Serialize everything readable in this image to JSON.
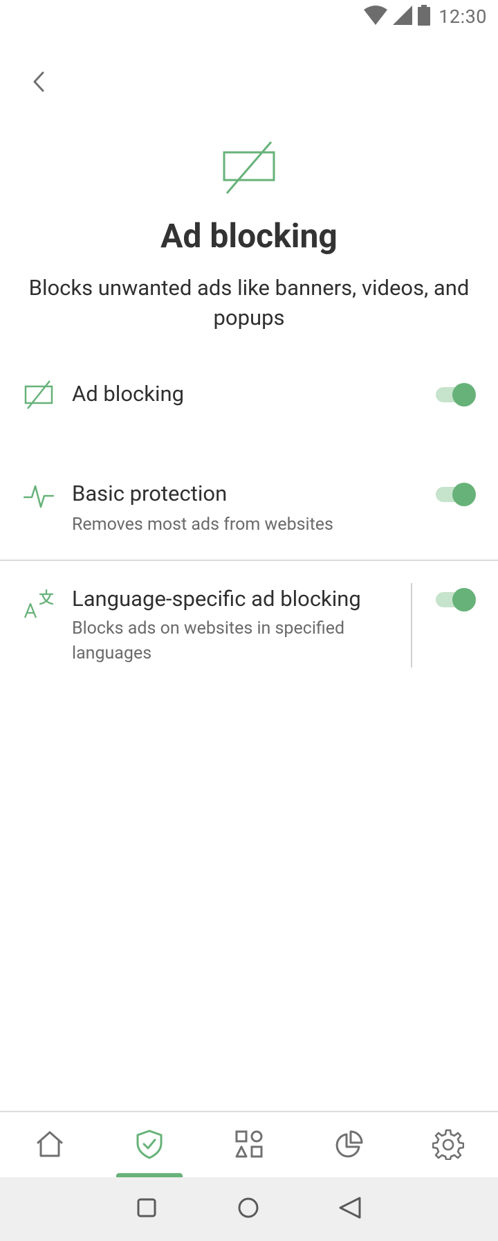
{
  "status_bar": {
    "time": "12:30",
    "icons": [
      "wifi-icon",
      "cell-signal-icon",
      "battery-icon"
    ]
  },
  "header": {
    "back_icon": "chevron-left-icon",
    "hero_icon": "ad-block-icon",
    "title": "Ad blocking",
    "subtitle": "Blocks unwanted ads like banners, videos, and popups"
  },
  "settings": [
    {
      "icon": "ad-block-icon",
      "title": "Ad blocking",
      "description": "",
      "enabled": true
    },
    {
      "icon": "pulse-icon",
      "title": "Basic protection",
      "description": "Removes most ads from websites",
      "enabled": true
    },
    {
      "icon": "translate-icon",
      "title": "Language-specific ad blocking",
      "description": "Blocks ads on websites in specified languages",
      "enabled": true
    }
  ],
  "bottom_nav": {
    "items": [
      {
        "icon": "home-icon",
        "active": false
      },
      {
        "icon": "shield-check-icon",
        "active": true
      },
      {
        "icon": "apps-icon",
        "active": false
      },
      {
        "icon": "pie-chart-icon",
        "active": false
      },
      {
        "icon": "gear-icon",
        "active": false
      }
    ]
  },
  "system_nav": {
    "icons": [
      "recents-square-icon",
      "home-circle-icon",
      "back-triangle-icon"
    ]
  },
  "colors": {
    "accent": "#67b279",
    "accent_light": "#c6e3cc",
    "text_primary": "#2f2f2f",
    "text_secondary": "#6a6a6a",
    "icon_gray": "#707070"
  }
}
